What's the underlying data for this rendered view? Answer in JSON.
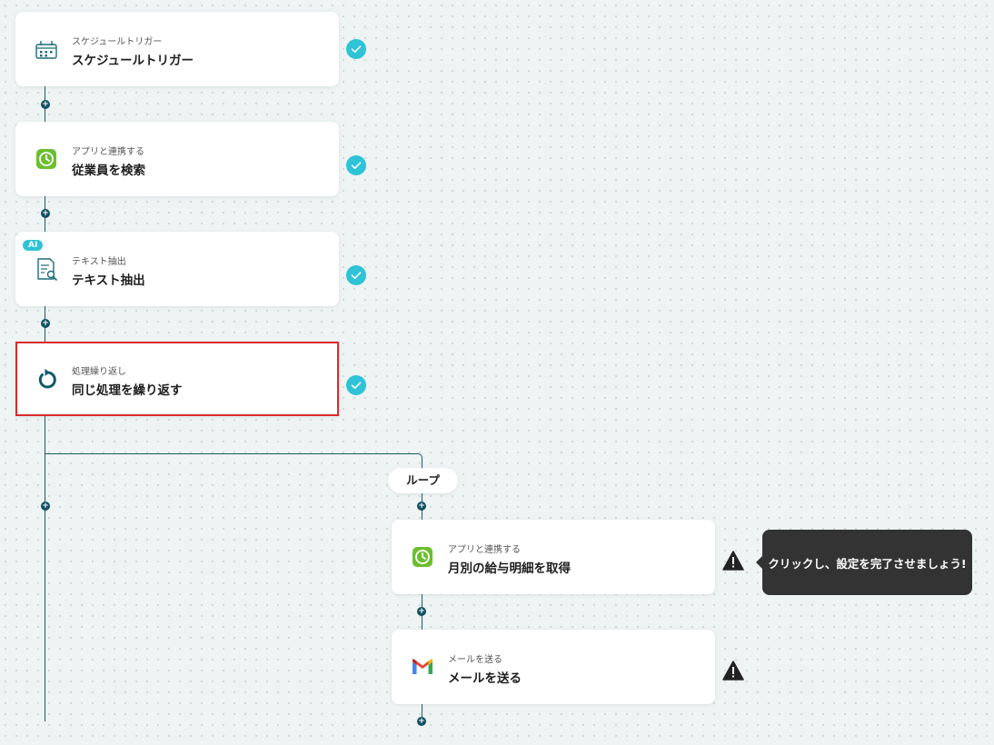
{
  "steps": [
    {
      "sub": "スケジュールトリガー",
      "title": "スケジュールトリガー",
      "icon": "calendar-icon",
      "status": "complete"
    },
    {
      "sub": "アプリと連携する",
      "title": "従業員を検索",
      "icon": "clock-app-icon",
      "status": "complete"
    },
    {
      "sub": "テキスト抽出",
      "title": "テキスト抽出",
      "icon": "document-search-icon",
      "status": "complete",
      "badge": "AI"
    },
    {
      "sub": "処理繰り返し",
      "title": "同じ処理を繰り返す",
      "icon": "loop-icon",
      "status": "complete",
      "selected": true
    },
    {
      "sub": "アプリと連携する",
      "title": "月別の給与明細を取得",
      "icon": "clock-app-icon",
      "status": "warning"
    },
    {
      "sub": "メールを送る",
      "title": "メールを送る",
      "icon": "gmail-icon",
      "status": "warning"
    }
  ],
  "loop_label": "ループ",
  "tooltip": "クリックし、設定を完了させましょう!",
  "colors": {
    "line": "#1d5a6a",
    "check": "#2ec3d6",
    "selected_border": "#d92b2b",
    "tooltip_bg": "#333333"
  }
}
